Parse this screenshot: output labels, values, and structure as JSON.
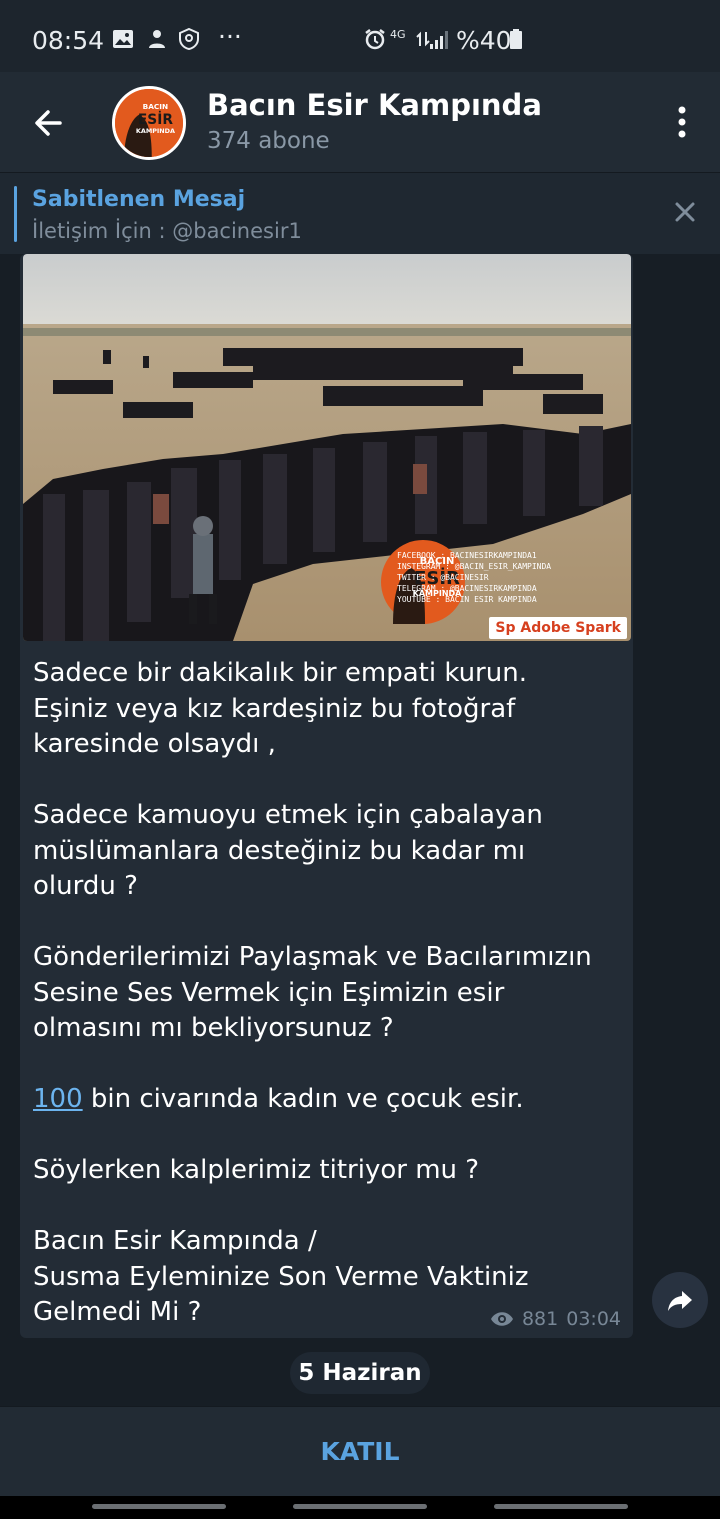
{
  "status_bar": {
    "time": "08:54",
    "more": "···",
    "battery": "%40",
    "network": "4G"
  },
  "header": {
    "title": "Bacın Esir Kampında",
    "subscribers": "374 abone",
    "avatar_text": [
      "BACIN",
      "ESİR",
      "KAMPINDA"
    ]
  },
  "pinned": {
    "title": "Sabitlenen Mesaj",
    "text": "İletişim İçin : @bacinesir1"
  },
  "post": {
    "image_caption": [
      "FACEBOOK : BACINESIRKAMPINDA1",
      "INSTEGRAM : @BACIN_ESIR_KAMPINDA",
      "TWITER : @BACINESIR",
      "TELEGRAM : @BACINESIRKAMPINDA",
      "YOUTUBE : BACIN ESIR KAMPINDA"
    ],
    "image_logo_text": [
      "BACIN",
      "ESİR",
      "KAMPINDA"
    ],
    "adobe_spark": "Sp Adobe Spark",
    "paragraphs": [
      [
        "Sadece bir dakikalık bir empati kurun.",
        "Eşiniz veya kız kardeşiniz bu fotoğraf",
        "karesinde olsaydı ,"
      ],
      [
        "Sadece kamuoyu etmek için çabalayan",
        "müslümanlara desteğiniz bu kadar mı",
        "olurdu ?"
      ],
      [
        "Gönderilerimizi Paylaşmak ve Bacılarımızın",
        "Sesine Ses Vermek için Eşimizin esir",
        "olmasını mı bekliyorsunuz ?"
      ]
    ],
    "link_number": "100",
    "link_rest": " bin civarında kadın ve çocuk esir.",
    "paragraph_5": "Söylerken kalplerimiz titriyor mu ?",
    "paragraph_6": [
      "Bacın Esir Kampında /",
      "Susma Eyleminize Son Verme Vaktiniz",
      "Gelmedi Mi ?"
    ],
    "views": "881",
    "time": "03:04"
  },
  "date_chip": "5 Haziran",
  "join_label": "KATIL",
  "colors": {
    "accent": "#5aa3e0",
    "bubble": "#232c36",
    "background": "#171e25",
    "logo_orange": "#e25a1e"
  },
  "icons": [
    "back-arrow-icon",
    "more-vert-icon",
    "close-icon",
    "eye-icon",
    "share-icon",
    "alarm-icon",
    "battery-icon",
    "signal-icon",
    "image-icon",
    "shield-icon"
  ]
}
